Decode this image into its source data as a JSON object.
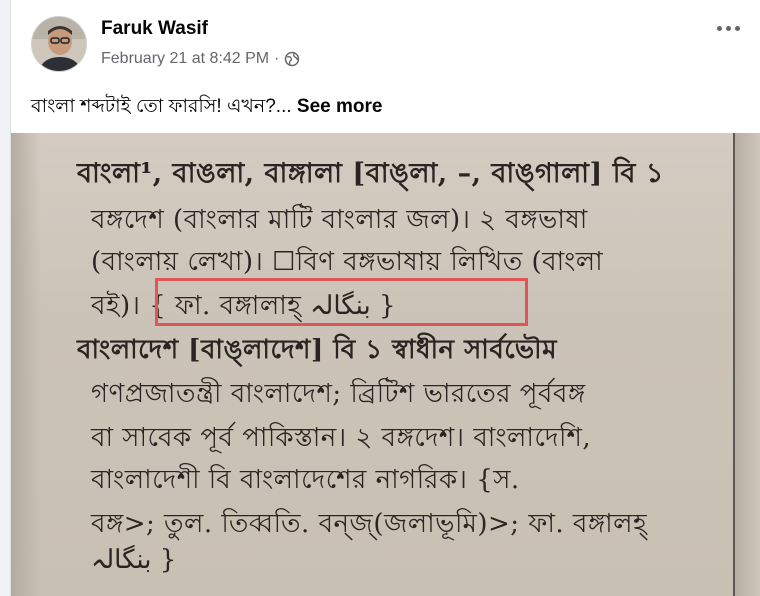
{
  "post": {
    "author": "Faruk Wasif",
    "timestamp": "February 21 at 8:42 PM",
    "separator": "·",
    "privacy_icon": "globe-icon",
    "text": "বাংলা শব্দটাই তো ফারসি! এখন?...",
    "see_more": "See more",
    "more_options_icon": "more-horizontal-icon"
  },
  "photo": {
    "lines": [
      "বাংলা¹, বাঙলা, বাঙ্গালা [বাঙ্‌লা, –, বাঙ্‌গালা] বি ১",
      "বঙ্গদেশ (বাংলার মাটি বাংলার জল)। ২ বঙ্গভাষা",
      "(বাংলায় লেখা)। ☐বিণ বঙ্গভাষায় লিখিত (বাংলা",
      "বই)। { ফা. বঙ্গালাহ্‌ بنگالہ }",
      "বাংলাদেশ [বাঙ্‌লাদেশ] বি ১ স্বাধীন সার্বভৌম",
      "গণপ্রজাতন্ত্রী বাংলাদেশ; ব্রিটিশ ভারতের পূর্ববঙ্গ",
      "বা সাবেক পূর্ব পাকিস্তান। ২ বঙ্গদেশ। বাংলাদেশি,",
      "বাংলাদেশী বি বাংলাদেশের নাগরিক। {স.",
      "বঙ্গ>; তুল. তিব্বতি. বন্‌জ্‌(জলাভূমি)>; ফা. বঙ্গালহ্‌",
      "بنگالہ }"
    ]
  }
}
